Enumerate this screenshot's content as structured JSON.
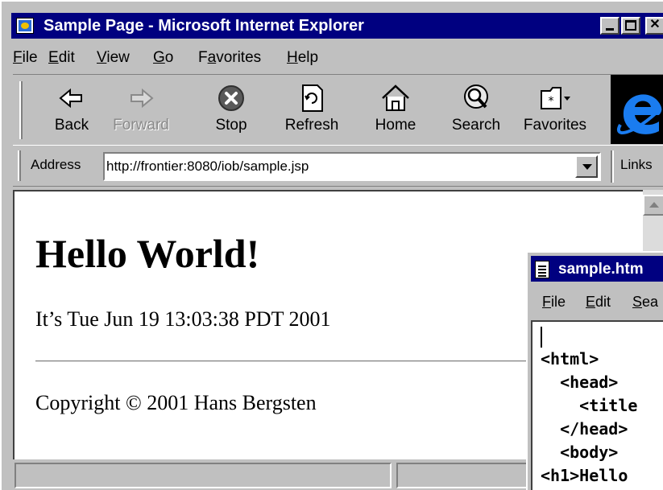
{
  "window": {
    "title": "Sample Page - Microsoft Internet Explorer"
  },
  "menu": {
    "file": {
      "ul": "F",
      "rest": "ile"
    },
    "edit": {
      "ul": "E",
      "rest": "dit"
    },
    "view": {
      "ul": "V",
      "rest": "iew"
    },
    "go": {
      "ul": "G",
      "rest": "o"
    },
    "favorites": {
      "pre": "F",
      "ul": "a",
      "rest": "vorites"
    },
    "help": {
      "ul": "H",
      "rest": "elp"
    }
  },
  "toolbar": {
    "back": "Back",
    "forward": "Forward",
    "stop": "Stop",
    "refresh": "Refresh",
    "home": "Home",
    "search": "Search",
    "favorites": "Favorites"
  },
  "address": {
    "label": "Address",
    "url": "http://frontier:8080/iob/sample.jsp",
    "links": "Links"
  },
  "page": {
    "heading": "Hello World!",
    "date_line": "It’s Tue Jun 19 13:03:38 PDT 2001",
    "copyright": "Copyright © 2001 Hans Bergsten"
  },
  "notepad": {
    "title": "sample.htm",
    "menu": {
      "file": {
        "ul": "F",
        "rest": "ile"
      },
      "edit": {
        "ul": "E",
        "rest": "dit"
      },
      "search": {
        "ul": "S",
        "rest": "ea"
      }
    },
    "lines": [
      "<html>",
      "  <head>",
      "    <title",
      "  </head>",
      "  <body>",
      "<h1>Hello"
    ]
  },
  "colors": {
    "titlebar": "#000080",
    "chrome": "#c0c0c0",
    "ie_blue": "#1a7cf0"
  },
  "icons": [
    "back-icon",
    "forward-icon",
    "stop-icon",
    "refresh-icon",
    "home-icon",
    "search-icon",
    "favorites-icon",
    "ie-logo-icon",
    "notepad-icon"
  ]
}
